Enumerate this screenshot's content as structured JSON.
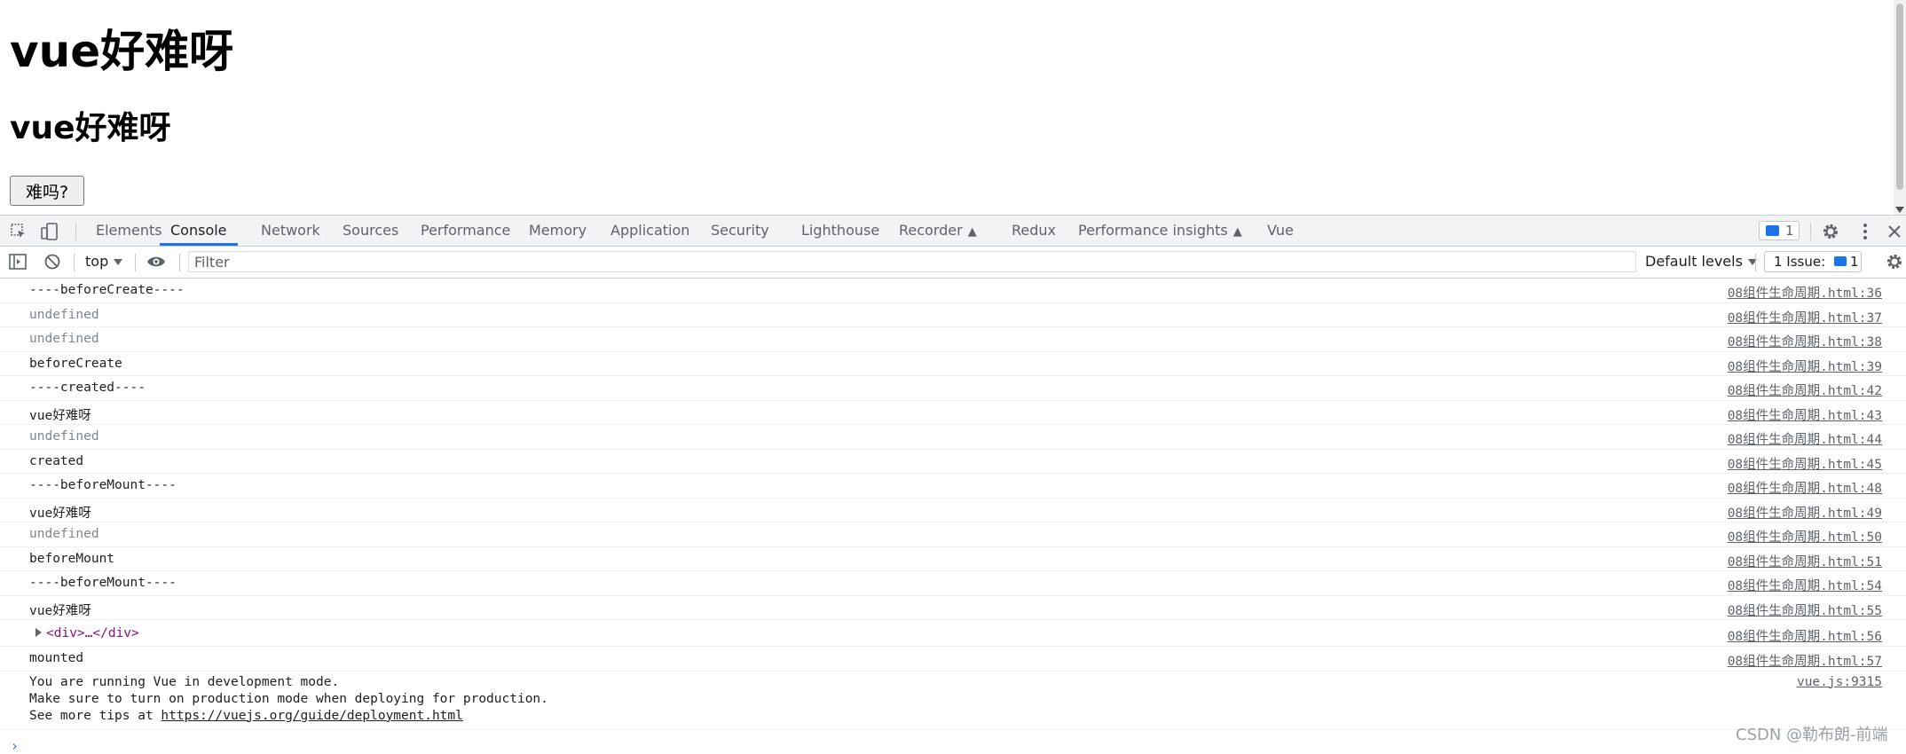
{
  "page": {
    "h1": "vue好难呀",
    "h2": "vue好难呀",
    "button_label": "难吗?"
  },
  "devtools": {
    "tabs": [
      {
        "label": "Elements"
      },
      {
        "label": "Console"
      },
      {
        "label": "Network"
      },
      {
        "label": "Sources"
      },
      {
        "label": "Performance"
      },
      {
        "label": "Memory"
      },
      {
        "label": "Application"
      },
      {
        "label": "Security"
      },
      {
        "label": "Lighthouse"
      },
      {
        "label": "Recorder",
        "experimental": true
      },
      {
        "label": "Redux"
      },
      {
        "label": "Performance insights",
        "experimental": true
      },
      {
        "label": "Vue"
      }
    ],
    "active_tab": "Console",
    "messages_count": "1",
    "accent_color": "#1a73e8"
  },
  "console_toolbar": {
    "context": "top",
    "filter_placeholder": "Filter",
    "levels": "Default levels",
    "issues_label": "1 Issue:",
    "issues_count": "1"
  },
  "log": [
    {
      "text": "----beforeCreate----",
      "dim": false,
      "src": "08组件生命周期.html:36"
    },
    {
      "text": "undefined",
      "dim": true,
      "src": "08组件生命周期.html:37"
    },
    {
      "text": "undefined",
      "dim": true,
      "src": "08组件生命周期.html:38"
    },
    {
      "text": "beforeCreate",
      "dim": false,
      "src": "08组件生命周期.html:39"
    },
    {
      "text": "----created----",
      "dim": false,
      "src": "08组件生命周期.html:42"
    },
    {
      "text": "vue好难呀",
      "dim": false,
      "src": "08组件生命周期.html:43"
    },
    {
      "text": "undefined",
      "dim": true,
      "src": "08组件生命周期.html:44"
    },
    {
      "text": "created",
      "dim": false,
      "src": "08组件生命周期.html:45"
    },
    {
      "text": "----beforeMount----",
      "dim": false,
      "src": "08组件生命周期.html:48"
    },
    {
      "text": "vue好难呀",
      "dim": false,
      "src": "08组件生命周期.html:49"
    },
    {
      "text": "undefined",
      "dim": true,
      "src": "08组件生命周期.html:50"
    },
    {
      "text": "beforeMount",
      "dim": false,
      "src": "08组件生命周期.html:51"
    },
    {
      "text": "----beforeMount----",
      "dim": false,
      "src": "08组件生命周期.html:54"
    },
    {
      "text": "vue好难呀",
      "dim": false,
      "src": "08组件生命周期.html:55"
    }
  ],
  "element_row": {
    "text": "<div>…</div>",
    "src": "08组件生命周期.html:56"
  },
  "mounted_row": {
    "text": "mounted",
    "src": "08组件生命周期.html:57"
  },
  "vue_notice": {
    "line1": "You are running Vue in development mode.",
    "line2": "Make sure to turn on production mode when deploying for production.",
    "line3_prefix": "See more tips at ",
    "link": "https://vuejs.org/guide/deployment.html",
    "src": "vue.js:9315"
  },
  "prompt": "›",
  "watermark": "CSDN @勒布朗-前端"
}
